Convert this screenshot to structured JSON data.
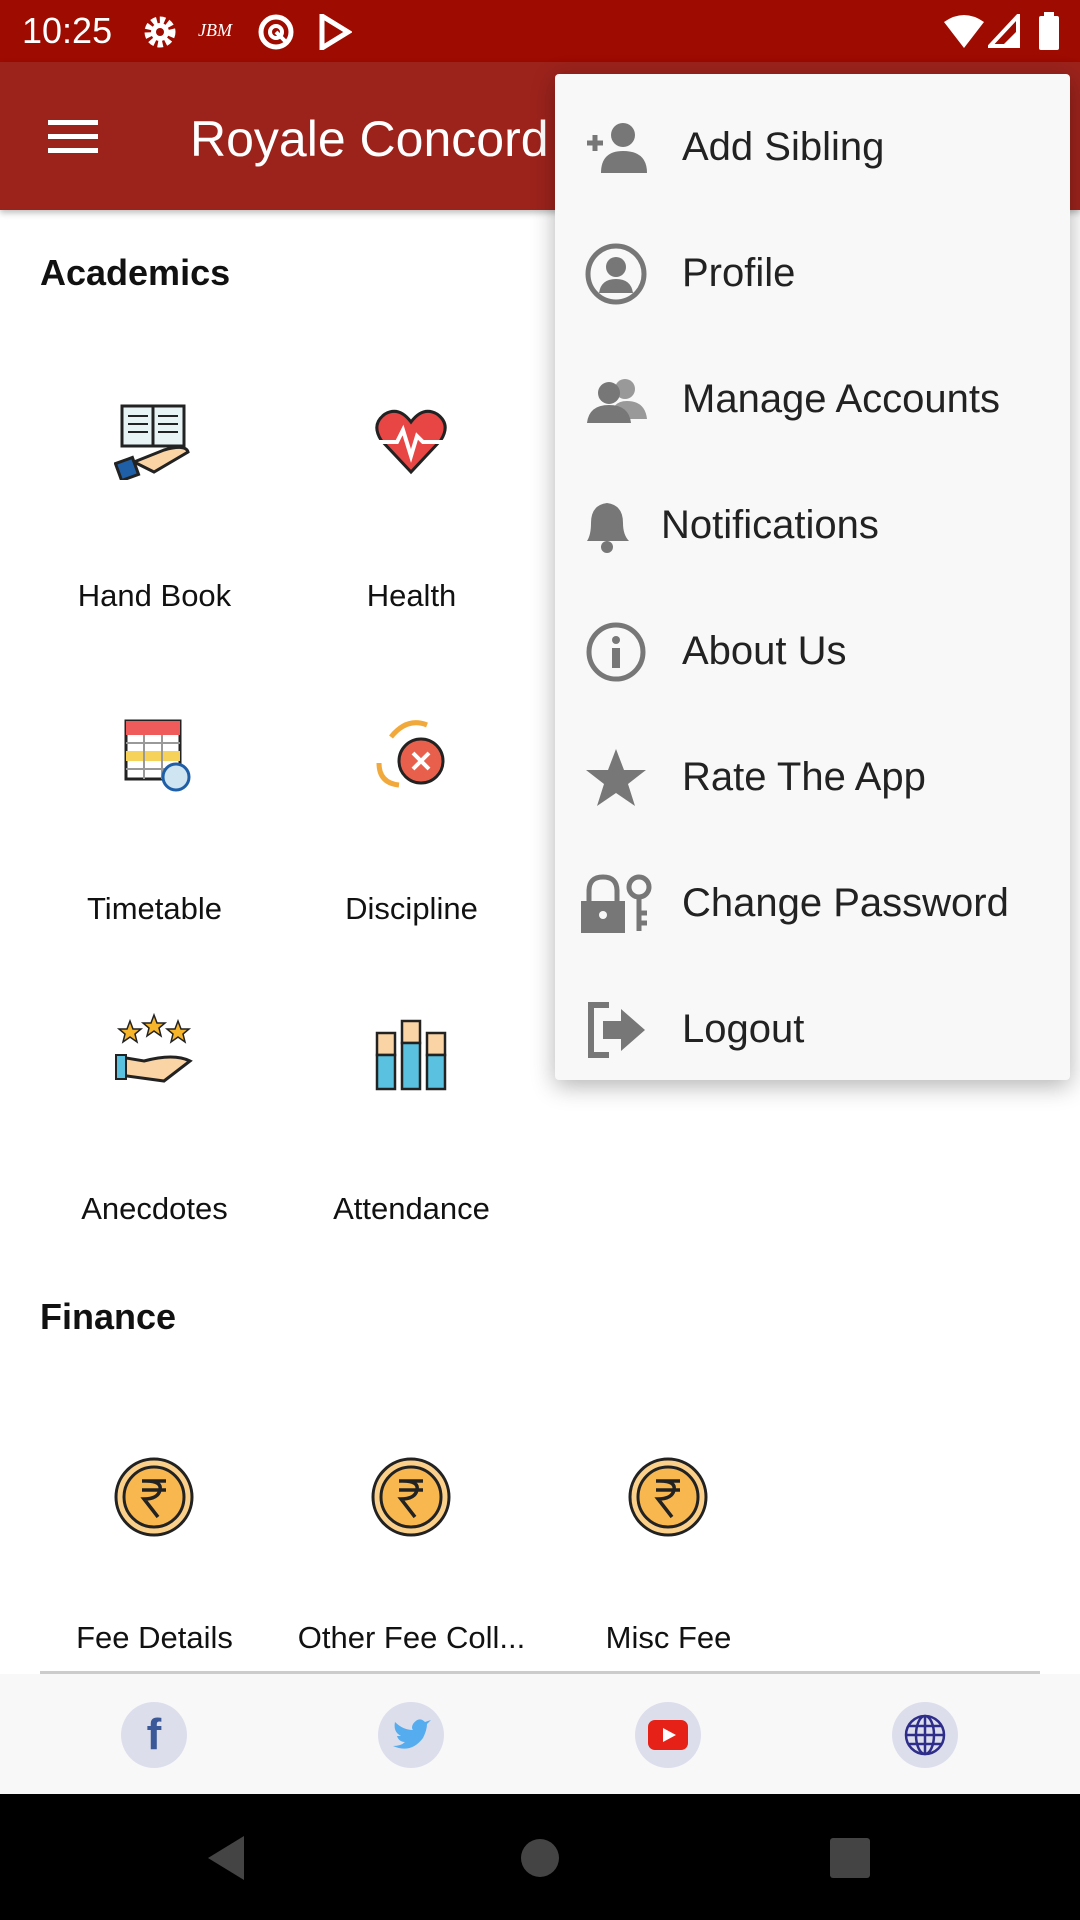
{
  "status_bar": {
    "time": "10:25",
    "icons": [
      "gear-icon",
      "jbm-icon",
      "vpn-icon",
      "play-store-icon",
      "wifi-icon",
      "signal-icon",
      "battery-icon"
    ]
  },
  "app_bar": {
    "title": "Royale Concord",
    "menu_icon": "hamburger-icon"
  },
  "academics": {
    "heading": "Academics",
    "items": [
      {
        "label": "Hand Book",
        "icon": "handbook-icon"
      },
      {
        "label": "Health",
        "icon": "heart-icon"
      },
      {
        "label": "Timetable",
        "icon": "calendar-icon"
      },
      {
        "label": "Discipline",
        "icon": "discipline-icon"
      },
      {
        "label": "Anecdotes",
        "icon": "stars-hand-icon"
      },
      {
        "label": "Attendance",
        "icon": "raised-hands-icon"
      }
    ]
  },
  "finance": {
    "heading": "Finance",
    "items": [
      {
        "label": "Fee Details",
        "icon": "rupee-coin-icon"
      },
      {
        "label": "Other Fee Coll...",
        "icon": "rupee-coin-icon"
      },
      {
        "label": "Misc Fee",
        "icon": "rupee-coin-icon"
      }
    ]
  },
  "footer": {
    "social": [
      "facebook-icon",
      "twitter-icon",
      "youtube-icon",
      "globe-icon"
    ]
  },
  "overflow_menu": {
    "items": [
      {
        "label": "Add Sibling",
        "icon": "add-person-icon"
      },
      {
        "label": "Profile",
        "icon": "profile-icon"
      },
      {
        "label": "Manage Accounts",
        "icon": "people-icon"
      },
      {
        "label": "Notifications",
        "icon": "bell-icon"
      },
      {
        "label": "About Us",
        "icon": "info-icon"
      },
      {
        "label": "Rate The App",
        "icon": "star-icon"
      },
      {
        "label": "Change Password",
        "icon": "lock-key-icon"
      },
      {
        "label": "Logout",
        "icon": "logout-icon"
      }
    ]
  },
  "colors": {
    "status_bar": "#9e0b00",
    "app_bar": "#9c231c",
    "menu_icon": "#777777"
  }
}
